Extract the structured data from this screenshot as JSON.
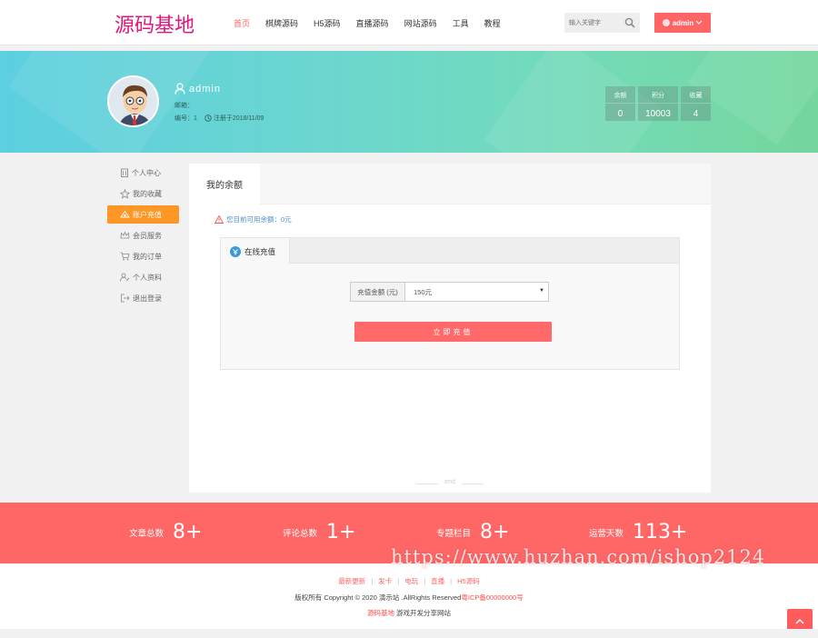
{
  "header": {
    "logo": "源码基地",
    "nav": [
      "首页",
      "棋牌源码",
      "H5源码",
      "直播源码",
      "网站源码",
      "工具",
      "教程"
    ],
    "search_placeholder": "输入关键字",
    "user_button": "admin"
  },
  "profile": {
    "username": "admin",
    "email_label": "邮箱：",
    "id_text": "编号：1",
    "registered": "注册于2018/11/09",
    "stats": [
      {
        "label": "余额",
        "value": "0"
      },
      {
        "label": "积分",
        "value": "10003"
      },
      {
        "label": "收藏",
        "value": "4"
      }
    ]
  },
  "sidebar": {
    "items": [
      {
        "label": "个人中心",
        "icon": "building-icon"
      },
      {
        "label": "我的收藏",
        "icon": "star-icon"
      },
      {
        "label": "账户充值",
        "icon": "recharge-icon",
        "active": true
      },
      {
        "label": "会员服务",
        "icon": "crown-icon"
      },
      {
        "label": "我的订单",
        "icon": "cart-icon"
      },
      {
        "label": "个人资料",
        "icon": "user-edit-icon"
      },
      {
        "label": "退出登录",
        "icon": "logout-icon"
      }
    ]
  },
  "main": {
    "tab": "我的余额",
    "notice": "您目前可用余额：0元",
    "online_tab": "在线充值",
    "amount_label": "充值金额 (元)",
    "amount_value": "150元",
    "pay_button": "立即充值",
    "end": "end"
  },
  "strip": [
    {
      "label": "文章总数",
      "value": "8+"
    },
    {
      "label": "评论总数",
      "value": "1+"
    },
    {
      "label": "专题栏目",
      "value": "8+"
    },
    {
      "label": "运营天数",
      "value": "113+"
    }
  ],
  "footer": {
    "links": [
      "最新更新",
      "发卡",
      "电玩",
      "直播",
      "H5源码"
    ],
    "copyright": "版权所有 Copyright © 2020 演示站 .AllRights Reserved",
    "icp": "粤ICP备00000000号",
    "brand": "源码基地",
    "tagline": "游戏开发分享网站"
  },
  "watermark": "https://www.huzhan.com/ishop2124",
  "colors": {
    "accent": "#ff6666",
    "logo": "#e3167a",
    "sidebar_active": "#ff9726"
  }
}
